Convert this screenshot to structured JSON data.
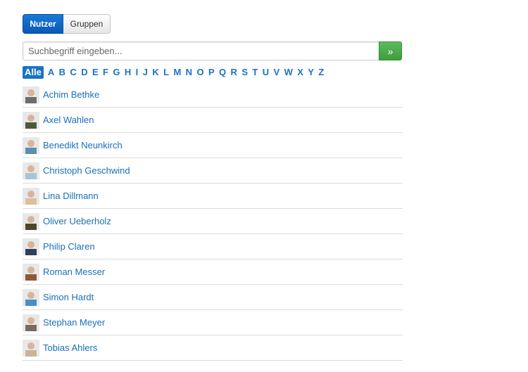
{
  "toggle": {
    "users_label": "Nutzer",
    "groups_label": "Gruppen"
  },
  "search": {
    "placeholder": "Suchbegriff eingeben...",
    "button_label": "»"
  },
  "letters": [
    "Alle",
    "A",
    "B",
    "C",
    "D",
    "E",
    "F",
    "G",
    "H",
    "I",
    "J",
    "K",
    "L",
    "M",
    "N",
    "O",
    "P",
    "Q",
    "R",
    "S",
    "T",
    "U",
    "V",
    "W",
    "X",
    "Y",
    "Z"
  ],
  "users": [
    {
      "name": "Achim Bethke",
      "avatar_color": "#6d6d6d"
    },
    {
      "name": "Axel Wahlen",
      "avatar_color": "#4a5a3a"
    },
    {
      "name": "Benedikt Neunkirch",
      "avatar_color": "#5a8fb0"
    },
    {
      "name": "Christoph Geschwind",
      "avatar_color": "#a8c4d8"
    },
    {
      "name": "Lina Dillmann",
      "avatar_color": "#d8c29a"
    },
    {
      "name": "Oliver Ueberholz",
      "avatar_color": "#4c4630"
    },
    {
      "name": "Philip Claren",
      "avatar_color": "#2e3f5a"
    },
    {
      "name": "Roman Messer",
      "avatar_color": "#8c5a3a"
    },
    {
      "name": "Simon Hardt",
      "avatar_color": "#4a8ec6"
    },
    {
      "name": "Stephan Meyer",
      "avatar_color": "#7a6a60"
    },
    {
      "name": "Tobias Ahlers",
      "avatar_color": "#c7b49a"
    }
  ]
}
